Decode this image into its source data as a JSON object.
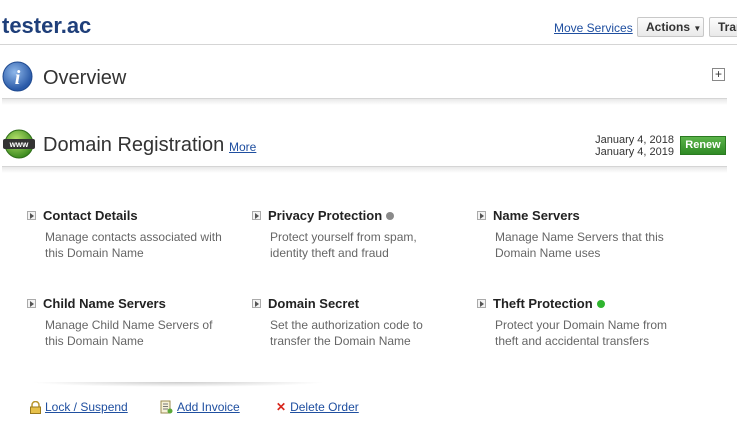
{
  "header": {
    "title": "tester.ac",
    "move_services": "Move Services",
    "actions": "Actions",
    "transfer": "Transfer"
  },
  "overview": {
    "title": "Overview",
    "expand": "+"
  },
  "registration": {
    "title": "Domain Registration",
    "more": "More",
    "date_start": "January 4, 2018",
    "date_end": "January 4, 2019",
    "renew": "Renew"
  },
  "tiles": [
    {
      "title": "Contact Details",
      "desc": "Manage contacts associated with this Domain Name"
    },
    {
      "title": "Privacy Protection",
      "desc": "Protect yourself from spam, identity theft and fraud",
      "status_color": "#8a8a8a"
    },
    {
      "title": "Name Servers",
      "desc": "Manage Name Servers that this Domain Name uses"
    },
    {
      "title": "Child Name Servers",
      "desc": "Manage Child Name Servers of this Domain Name"
    },
    {
      "title": "Domain Secret",
      "desc": "Set the authorization code to transfer the Domain Name"
    },
    {
      "title": "Theft Protection",
      "desc": "Protect your Domain Name from theft and accidental transfers",
      "status_color": "#2fb52f"
    }
  ],
  "footer": {
    "lock": "Lock / Suspend",
    "invoice": "Add Invoice",
    "delete": "Delete Order"
  },
  "colors": {
    "link": "#1f4fa0",
    "title": "#1f3f7a",
    "renew": "#3f9a30"
  }
}
